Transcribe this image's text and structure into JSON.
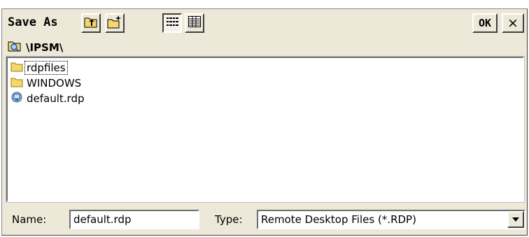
{
  "dialog": {
    "title": "Save As",
    "ok_label": "OK",
    "close_label": "×"
  },
  "toolbar": {
    "buttons": [
      {
        "icon": "up-folder-icon"
      },
      {
        "icon": "new-folder-icon"
      },
      {
        "icon": "list-view-icon",
        "pressed": true
      },
      {
        "icon": "details-view-icon"
      }
    ]
  },
  "path": {
    "icon": "folder-search-icon",
    "text": "\\IPSM\\"
  },
  "files": [
    {
      "name": "rdpfiles",
      "icon": "folder-icon",
      "focused": true
    },
    {
      "name": "WINDOWS",
      "icon": "folder-icon"
    },
    {
      "name": "default.rdp",
      "icon": "remote-desktop-file-icon"
    }
  ],
  "bottom": {
    "name_label": "Name:",
    "name_value": "default.rdp",
    "type_label": "Type:",
    "type_value": "Remote Desktop Files (*.RDP)"
  },
  "colors": {
    "dialog_bg": "#ece9d8",
    "folder_yellow": "#f5d76e"
  }
}
